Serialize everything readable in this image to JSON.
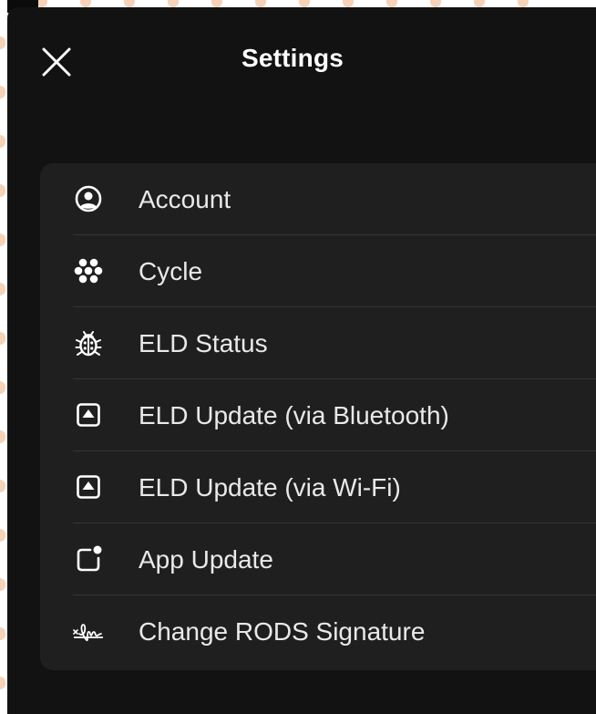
{
  "header": {
    "title": "Settings",
    "close_icon": "close-icon"
  },
  "settings": {
    "items": [
      {
        "label": "Account",
        "icon": "account-circle-icon"
      },
      {
        "label": "Cycle",
        "icon": "cycle-flower-icon"
      },
      {
        "label": "ELD Status",
        "icon": "bug-icon"
      },
      {
        "label": "ELD Update (via Bluetooth)",
        "icon": "upload-box-icon"
      },
      {
        "label": "ELD Update (via Wi-Fi)",
        "icon": "upload-box-icon"
      },
      {
        "label": "App Update",
        "icon": "app-badge-icon"
      },
      {
        "label": "Change RODS Signature",
        "icon": "signature-icon"
      }
    ]
  },
  "colors": {
    "background": "#121212",
    "card": "#1f1f1f",
    "text": "#e9e9e9",
    "separator": "#353535"
  }
}
